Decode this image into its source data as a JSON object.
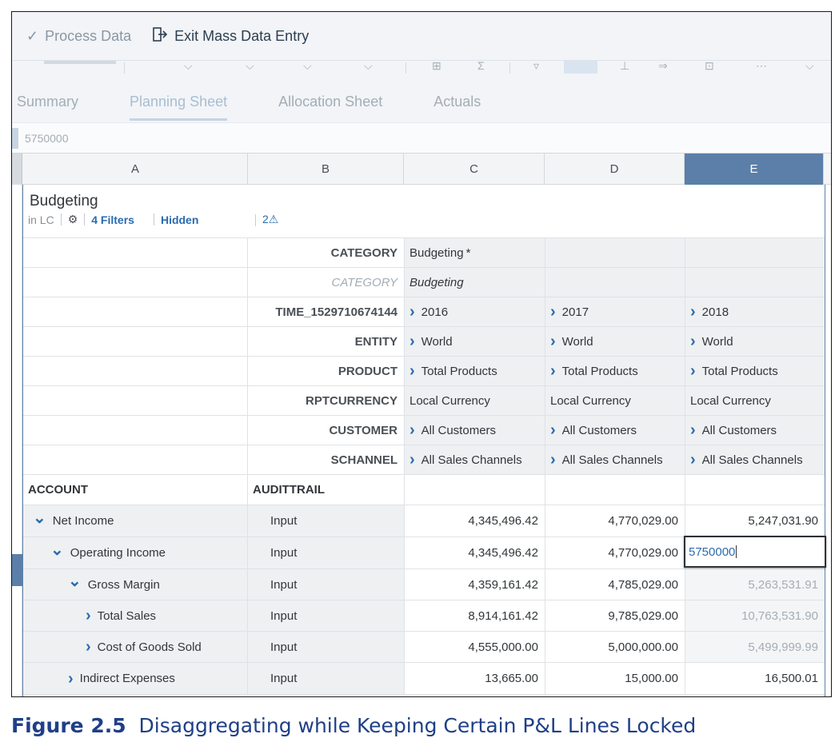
{
  "actionbar": {
    "process_label": "Process Data",
    "exit_label": "Exit Mass Data Entry"
  },
  "tabs": [
    {
      "label": "Summary",
      "active": false
    },
    {
      "label": "Planning Sheet",
      "active": true
    },
    {
      "label": "Allocation Sheet",
      "active": false
    },
    {
      "label": "Actuals",
      "active": false
    }
  ],
  "formula_bar": {
    "value": "5750000"
  },
  "columns": [
    "A",
    "B",
    "C",
    "D",
    "E"
  ],
  "selected_column": "E",
  "table_title": {
    "title": "Budgeting",
    "in_lc": "in LC",
    "filters": "4 Filters",
    "hidden": "Hidden",
    "warnings": "2"
  },
  "header_rows": [
    {
      "dim": "CATEGORY",
      "c": "Budgeting",
      "c_mark": "*",
      "d": "",
      "e": "",
      "chev": false
    },
    {
      "dim": "CATEGORY",
      "c": "Budgeting",
      "d": "",
      "e": "",
      "chev": false,
      "italic": true
    },
    {
      "dim": "TIME_1529710674144",
      "c": "2016",
      "d": "2017",
      "e": "2018",
      "chev": true
    },
    {
      "dim": "ENTITY",
      "c": "World",
      "d": "World",
      "e": "World",
      "chev": true
    },
    {
      "dim": "PRODUCT",
      "c": "Total Products",
      "d": "Total Products",
      "e": "Total Products",
      "chev": true
    },
    {
      "dim": "RPTCURRENCY",
      "c": "Local Currency",
      "d": "Local Currency",
      "e": "Local Currency",
      "chev": false
    },
    {
      "dim": "CUSTOMER",
      "c": "All Customers",
      "d": "All Customers",
      "e": "All Customers",
      "chev": true
    },
    {
      "dim": "SCHANNEL",
      "c": "All Sales Channels",
      "d": "All Sales Channels",
      "e": "All Sales Channels",
      "chev": true
    }
  ],
  "column_headers": {
    "a": "ACCOUNT",
    "b": "AUDITTRAIL"
  },
  "data_rows": [
    {
      "account": "Net Income",
      "expanded": true,
      "indent": 0,
      "audit": "Input",
      "c": "4,345,496.42",
      "d": "4,770,029.00",
      "e": "5,247,031.90",
      "locked": false
    },
    {
      "account": "Operating Income",
      "expanded": true,
      "indent": 1,
      "audit": "Input",
      "c": "4,345,496.42",
      "d": "4,770,029.00",
      "e": "5750000",
      "editing": true,
      "locked": false
    },
    {
      "account": "Gross Margin",
      "expanded": true,
      "indent": 2,
      "audit": "Input",
      "c": "4,359,161.42",
      "d": "4,785,029.00",
      "e": "5,263,531.91",
      "locked": true
    },
    {
      "account": "Total Sales",
      "expanded": false,
      "indent": 3,
      "audit": "Input",
      "c": "8,914,161.42",
      "d": "9,785,029.00",
      "e": "10,763,531.90",
      "locked": true
    },
    {
      "account": "Cost of Goods Sold",
      "expanded": false,
      "indent": 3,
      "audit": "Input",
      "c": "4,555,000.00",
      "d": "5,000,000.00",
      "e": "5,499,999.99",
      "locked": true
    },
    {
      "account": "Indirect Expenses",
      "expanded": false,
      "indent": 2,
      "audit": "Input",
      "c": "13,665.00",
      "d": "15,000.00",
      "e": "16,500.01",
      "locked": false
    }
  ],
  "caption": {
    "figure": "Figure 2.5",
    "text": "Disaggregating while Keeping Certain P&L Lines Locked"
  },
  "colors": {
    "selected_column": "#5b7fa8",
    "link": "#2a6bb0",
    "caption": "#1f3f87"
  }
}
